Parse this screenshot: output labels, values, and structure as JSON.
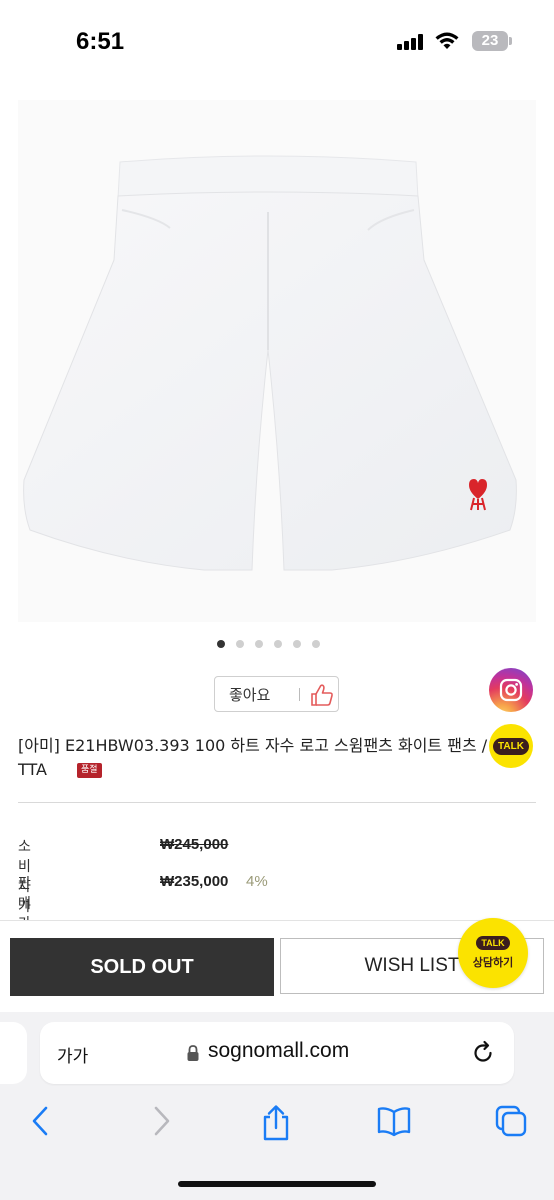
{
  "status_bar": {
    "time": "6:51",
    "battery": "23"
  },
  "product": {
    "title": "[아미] E21HBW03.393 100 하트 자수 로고 스윔팬츠 화이트 팬츠 / TTA",
    "badge": "품절",
    "like_label": "좋아요",
    "carousel": {
      "count": 6,
      "active": 1
    }
  },
  "prices": {
    "consumer_label": "소비자가",
    "consumer_price": "₩245,000",
    "sale_label": "판매가",
    "sale_price": "₩235,000",
    "discount": "4%"
  },
  "actions": {
    "sold_out": "SOLD OUT",
    "wish_list": "WISH LIST"
  },
  "floating": {
    "instagram_icon": "instagram-icon",
    "talk_small": "TALK",
    "talk_large": "TALK",
    "consult_label": "상담하기"
  },
  "browser": {
    "aa_label": "가가",
    "url": "sognomall.com"
  },
  "colors": {
    "sold_out_bg": "#333333",
    "kakao_yellow": "#fbe300",
    "badge_red": "#b5232b",
    "heart_logo_red": "#d9252b"
  }
}
